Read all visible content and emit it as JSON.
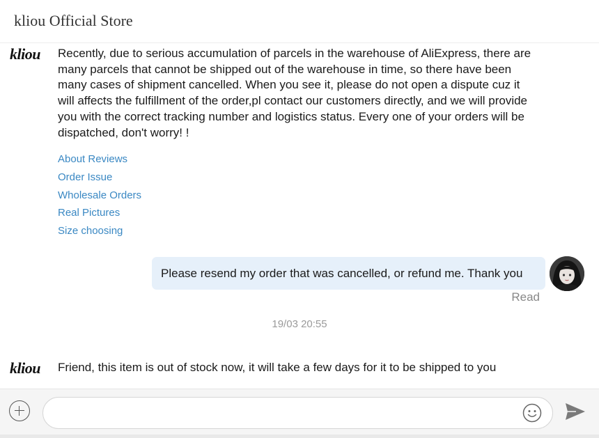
{
  "header": {
    "store_name": "kliou Official Store"
  },
  "store_logo": "kliou",
  "messages": {
    "auto_reply": "Recently, due to serious accumulation of parcels in the warehouse of AliExpress, there are many parcels that cannot be shipped out of the warehouse in time, so  there have been many cases of shipment cancelled. When you see it, please do not open a dispute cuz it will affects the fulfillment of the order,pl contact our customers directly, and we will provide you with the correct tracking number and logistics status. Every one of your orders will be dispatched, don't worry! !",
    "quick_links": [
      "About Reviews",
      "Order Issue",
      "Wholesale Orders",
      "Real Pictures",
      "Size choosing"
    ],
    "user_message": "Please resend my order that was cancelled, or refund me. Thank you",
    "read_status": "Read",
    "timestamp": "19/03 20:55",
    "seller_reply": "Friend, this item is out of stock now, it will take a few days for it to be shipped to you"
  },
  "composer": {
    "input_value": "",
    "icons": [
      "plus-icon",
      "emoji-icon",
      "send-icon"
    ]
  },
  "colors": {
    "link": "#3a88c3",
    "user_bubble": "#e6f0fa",
    "muted_text": "#888888"
  }
}
